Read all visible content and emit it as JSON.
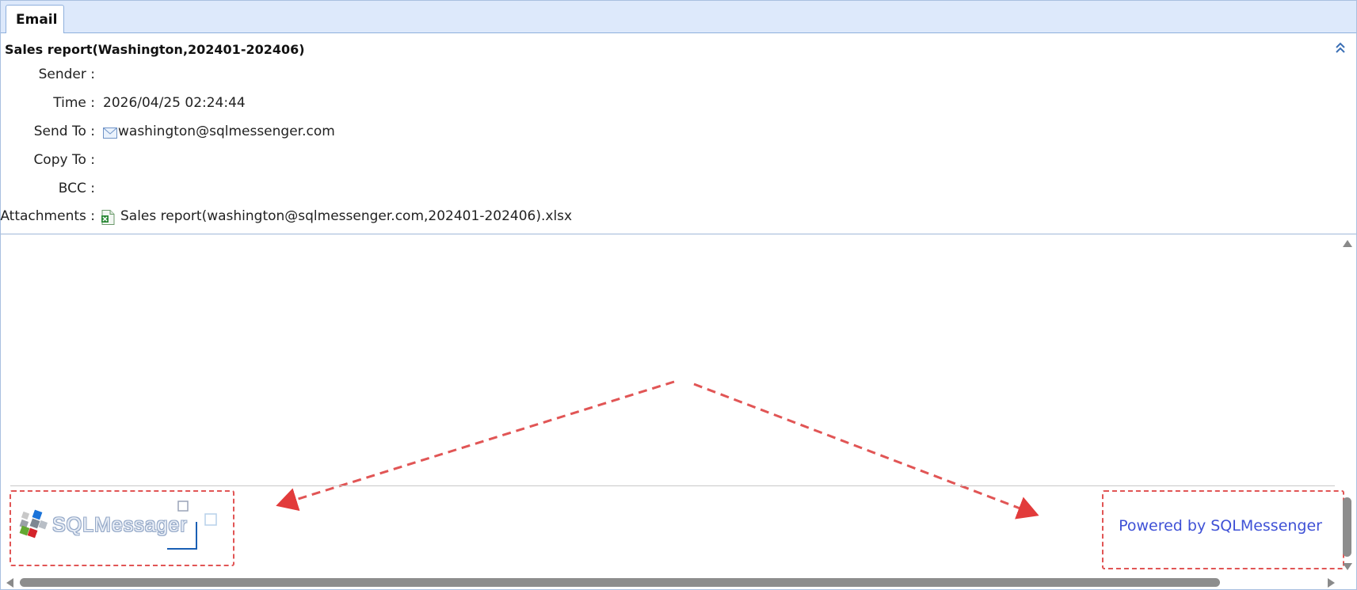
{
  "tab": {
    "label": "Email"
  },
  "email": {
    "subject": "Sales report(Washington,202401-202406)",
    "fields": [
      {
        "label": "Sender :",
        "value": ""
      },
      {
        "label": "Time :",
        "value": "2026/04/25 02:24:44"
      },
      {
        "label": "Send To :",
        "value": "washington@sqlmessenger.com"
      },
      {
        "label": "Copy To :",
        "value": ""
      },
      {
        "label": "BCC :",
        "value": ""
      },
      {
        "label": "Attachments :",
        "value": "Sales report(washington@sqlmessenger.com,202401-202406).xlsx"
      }
    ]
  },
  "body": {
    "logo_text": "SQLMessager",
    "powered_by": "Powered by SQLMessenger"
  },
  "icons": {
    "collapse": "double-chevron-up-icon",
    "recipient": "envelope-icon",
    "attachment": "excel-file-icon",
    "logo": "sqlmessenger-cubes-logo"
  },
  "colors": {
    "tab_strip": "#dde9fb",
    "annotation_dash": "#e15555",
    "link": "#3f51d6"
  }
}
